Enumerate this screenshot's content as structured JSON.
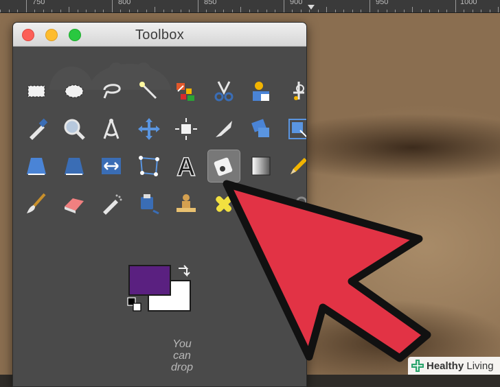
{
  "ruler": {
    "labels": [
      "750",
      "800",
      "850",
      "900",
      "950",
      "1000"
    ]
  },
  "window": {
    "title": "Toolbox"
  },
  "tools": [
    {
      "name": "rect-select-tool",
      "icon": "rect-select-icon"
    },
    {
      "name": "ellipse-select-tool",
      "icon": "ellipse-select-icon"
    },
    {
      "name": "free-select-tool",
      "icon": "lasso-icon"
    },
    {
      "name": "fuzzy-select-tool",
      "icon": "magic-wand-icon"
    },
    {
      "name": "select-by-color-tool",
      "icon": "color-select-icon"
    },
    {
      "name": "scissors-select-tool",
      "icon": "scissors-icon"
    },
    {
      "name": "foreground-select-tool",
      "icon": "foreground-select-icon"
    },
    {
      "name": "paths-tool",
      "icon": "pen-path-icon"
    },
    {
      "name": "color-picker-tool",
      "icon": "eyedropper-icon"
    },
    {
      "name": "zoom-tool",
      "icon": "magnifier-icon"
    },
    {
      "name": "measure-tool",
      "icon": "compass-icon"
    },
    {
      "name": "move-tool",
      "icon": "move-arrows-icon"
    },
    {
      "name": "align-tool",
      "icon": "align-icon"
    },
    {
      "name": "crop-tool",
      "icon": "scalpel-icon"
    },
    {
      "name": "rotate-tool",
      "icon": "rotate-icon"
    },
    {
      "name": "scale-tool",
      "icon": "scale-icon"
    },
    {
      "name": "shear-tool",
      "icon": "shear-icon"
    },
    {
      "name": "perspective-tool",
      "icon": "perspective-icon"
    },
    {
      "name": "flip-tool",
      "icon": "flip-icon"
    },
    {
      "name": "cage-transform-tool",
      "icon": "cage-icon"
    },
    {
      "name": "text-tool",
      "icon": "text-a-icon"
    },
    {
      "name": "bucket-fill-tool",
      "icon": "bucket-fill-icon"
    },
    {
      "name": "blend-tool",
      "icon": "gradient-icon"
    },
    {
      "name": "pencil-tool",
      "icon": "pencil-icon"
    },
    {
      "name": "paintbrush-tool",
      "icon": "paintbrush-icon"
    },
    {
      "name": "eraser-tool",
      "icon": "eraser-icon"
    },
    {
      "name": "airbrush-tool",
      "icon": "airbrush-icon"
    },
    {
      "name": "ink-tool",
      "icon": "ink-icon"
    },
    {
      "name": "clone-tool",
      "icon": "stamp-icon"
    },
    {
      "name": "heal-tool",
      "icon": "bandage-icon"
    },
    {
      "name": "smudge-tool",
      "icon": "smudge-icon"
    },
    {
      "name": "dodge-burn-tool",
      "icon": "dodge-burn-icon"
    }
  ],
  "active_tool": "bucket-fill-tool",
  "colors": {
    "foreground": "#5a2080",
    "background": "#ffffff",
    "annotation_arrow": "#e23345"
  },
  "drop_hint": "You can drop",
  "watermark": {
    "brand_bold": "Healthy",
    "brand_rest": " Living"
  }
}
